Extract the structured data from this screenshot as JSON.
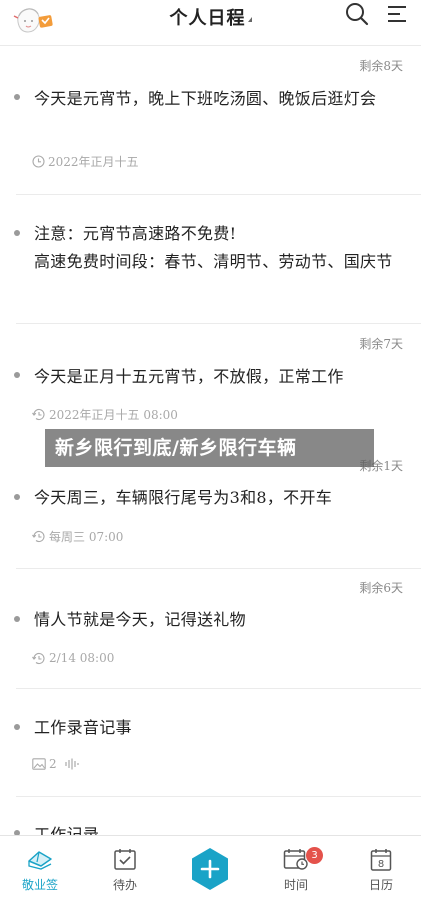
{
  "header": {
    "title": "个人日程"
  },
  "items": [
    {
      "remain": "剩余8天",
      "text": "今天是元宵节，晚上下班吃汤圆、晚饭后逛灯会",
      "meta": "2022年正月十五",
      "meta_icon": "clock-icon"
    },
    {
      "remain": "",
      "text": "注意：元宵节高速路不免费!\n高速免费时间段：春节、清明节、劳动节、国庆节",
      "meta": "",
      "meta_icon": ""
    },
    {
      "remain": "剩余7天",
      "text": "今天是正月十五元宵节，不放假，正常工作",
      "meta": "2022年正月十五  08:00",
      "meta_icon": "repeat-clock-icon"
    },
    {
      "remain": "剩余1天",
      "text": "今天周三，车辆限行尾号为3和8，不开车",
      "meta": "每周三  07:00",
      "meta_icon": "repeat-clock-icon"
    },
    {
      "remain": "剩余6天",
      "text": "情人节就是今天，记得送礼物",
      "meta": "2/14  08:00",
      "meta_icon": "repeat-clock-icon"
    },
    {
      "remain": "",
      "text": "工作录音记事",
      "meta": "2",
      "meta_icon": "image-icon"
    },
    {
      "remain": "",
      "text": "工作记录",
      "meta": "",
      "meta_icon": ""
    }
  ],
  "watermark": "新乡限行到底/新乡限行车辆",
  "tabbar": {
    "tabs": [
      {
        "label": "敬业签",
        "icon": "cap-icon",
        "active": true
      },
      {
        "label": "待办",
        "icon": "checkbox-icon",
        "active": false
      },
      {
        "label": "",
        "icon": "add-icon",
        "active": false
      },
      {
        "label": "时间",
        "icon": "calendar-clock-icon",
        "active": false,
        "badge": "3"
      },
      {
        "label": "日历",
        "icon": "calendar-icon",
        "active": false
      }
    ],
    "calendar_day": "8"
  },
  "colors": {
    "accent": "#1aa3c7",
    "badge": "#e4524b",
    "text": "#222222",
    "muted": "#a8a8a8"
  }
}
